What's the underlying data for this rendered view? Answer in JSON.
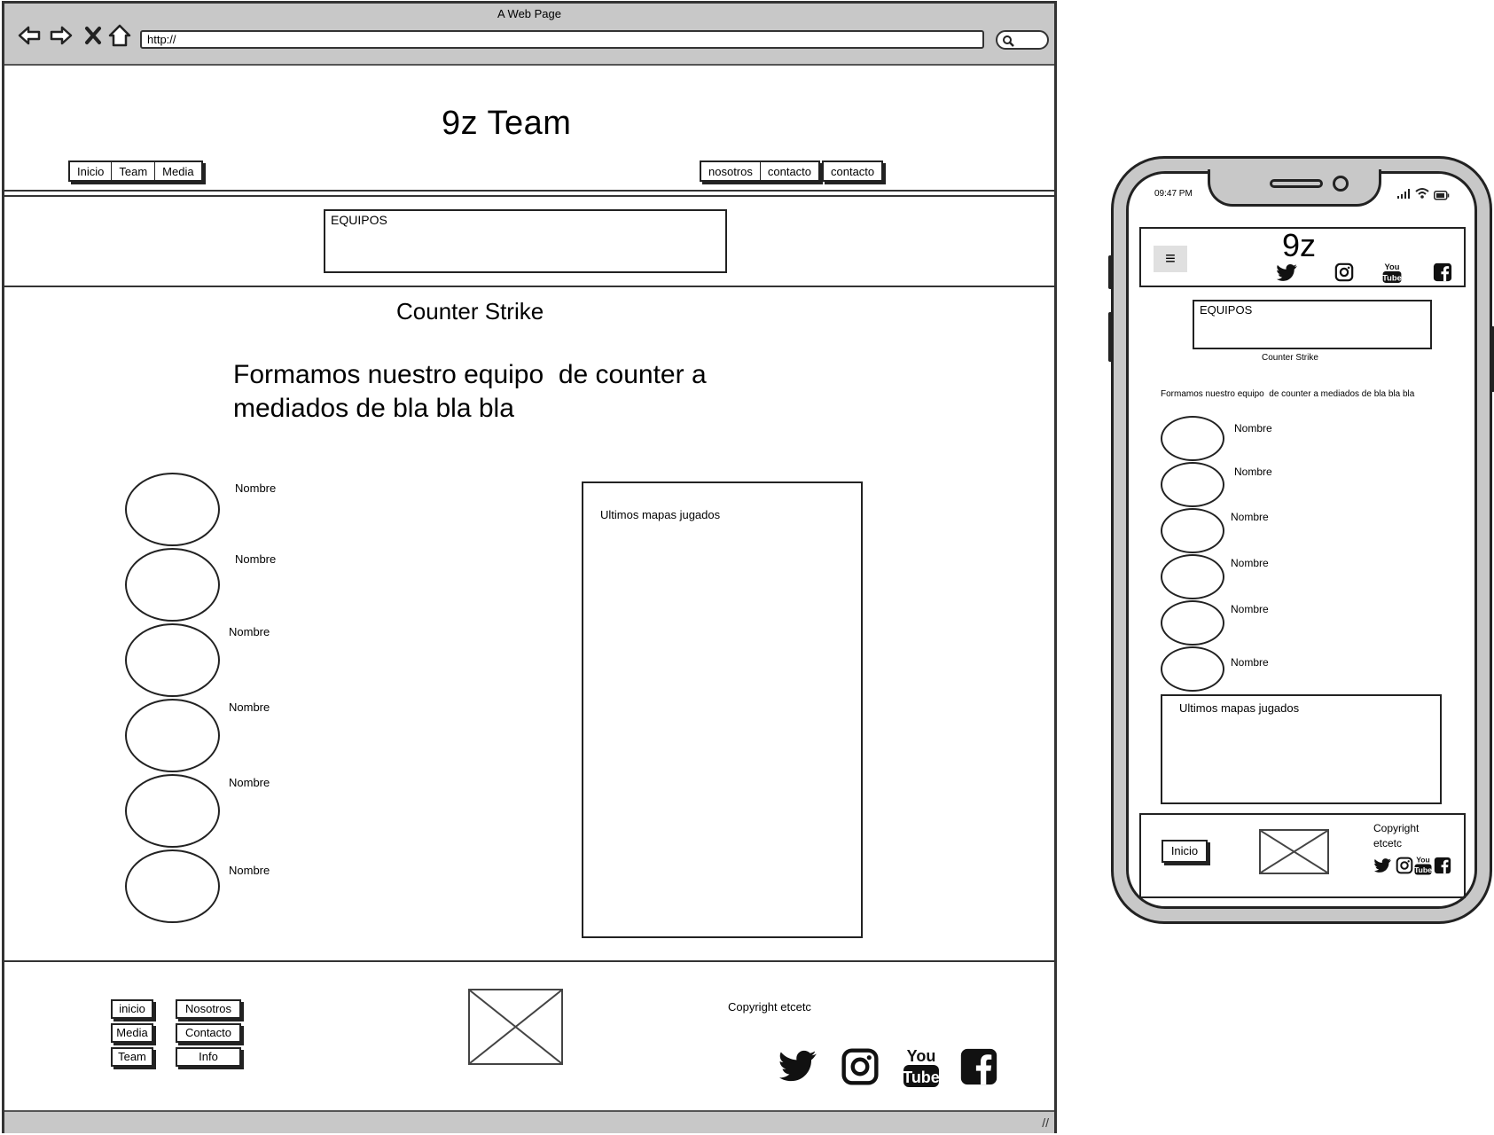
{
  "browser": {
    "window_title": "A Web Page",
    "url": "http://"
  },
  "site": {
    "title": "9z Team",
    "nav_left": [
      "Inicio",
      "Team",
      "Media"
    ],
    "nav_right_group": [
      "nosotros",
      "contacto"
    ],
    "nav_right_single": "contacto",
    "section_box_label": "EQUIPOS",
    "game_title": "Counter Strike",
    "intro_text_line1": "Formamos nuestro equipo  de counter a",
    "intro_text_line2": "mediados de bla bla bla",
    "players": [
      "Nombre",
      "Nombre",
      "Nombre",
      "Nombre",
      "Nombre",
      "Nombre"
    ],
    "maps_panel_label": "Ultimos mapas jugados",
    "footer_buttons": [
      "inicio",
      "Nosotros",
      "Media",
      "Contacto",
      "Team",
      "Info"
    ],
    "copyright": "Copyright etcetc",
    "social_icons": [
      "twitter-icon",
      "instagram-icon",
      "youtube-icon",
      "facebook-icon"
    ]
  },
  "phone": {
    "time": "09:47 PM",
    "title": "9z",
    "section_box_label": "EQUIPOS",
    "game_title": "Counter Strike",
    "intro_text": "Formamos nuestro equipo  de counter a mediados de bla bla bla",
    "players": [
      "Nombre",
      "Nombre",
      "Nombre",
      "Nombre",
      "Nombre",
      "Nombre"
    ],
    "maps_panel_label": "Ultimos mapas jugados",
    "footer_button": "Inicio",
    "copyright_line1": "Copyright",
    "copyright_line2": "etcetc",
    "menu_icon": "hamburger-icon"
  }
}
